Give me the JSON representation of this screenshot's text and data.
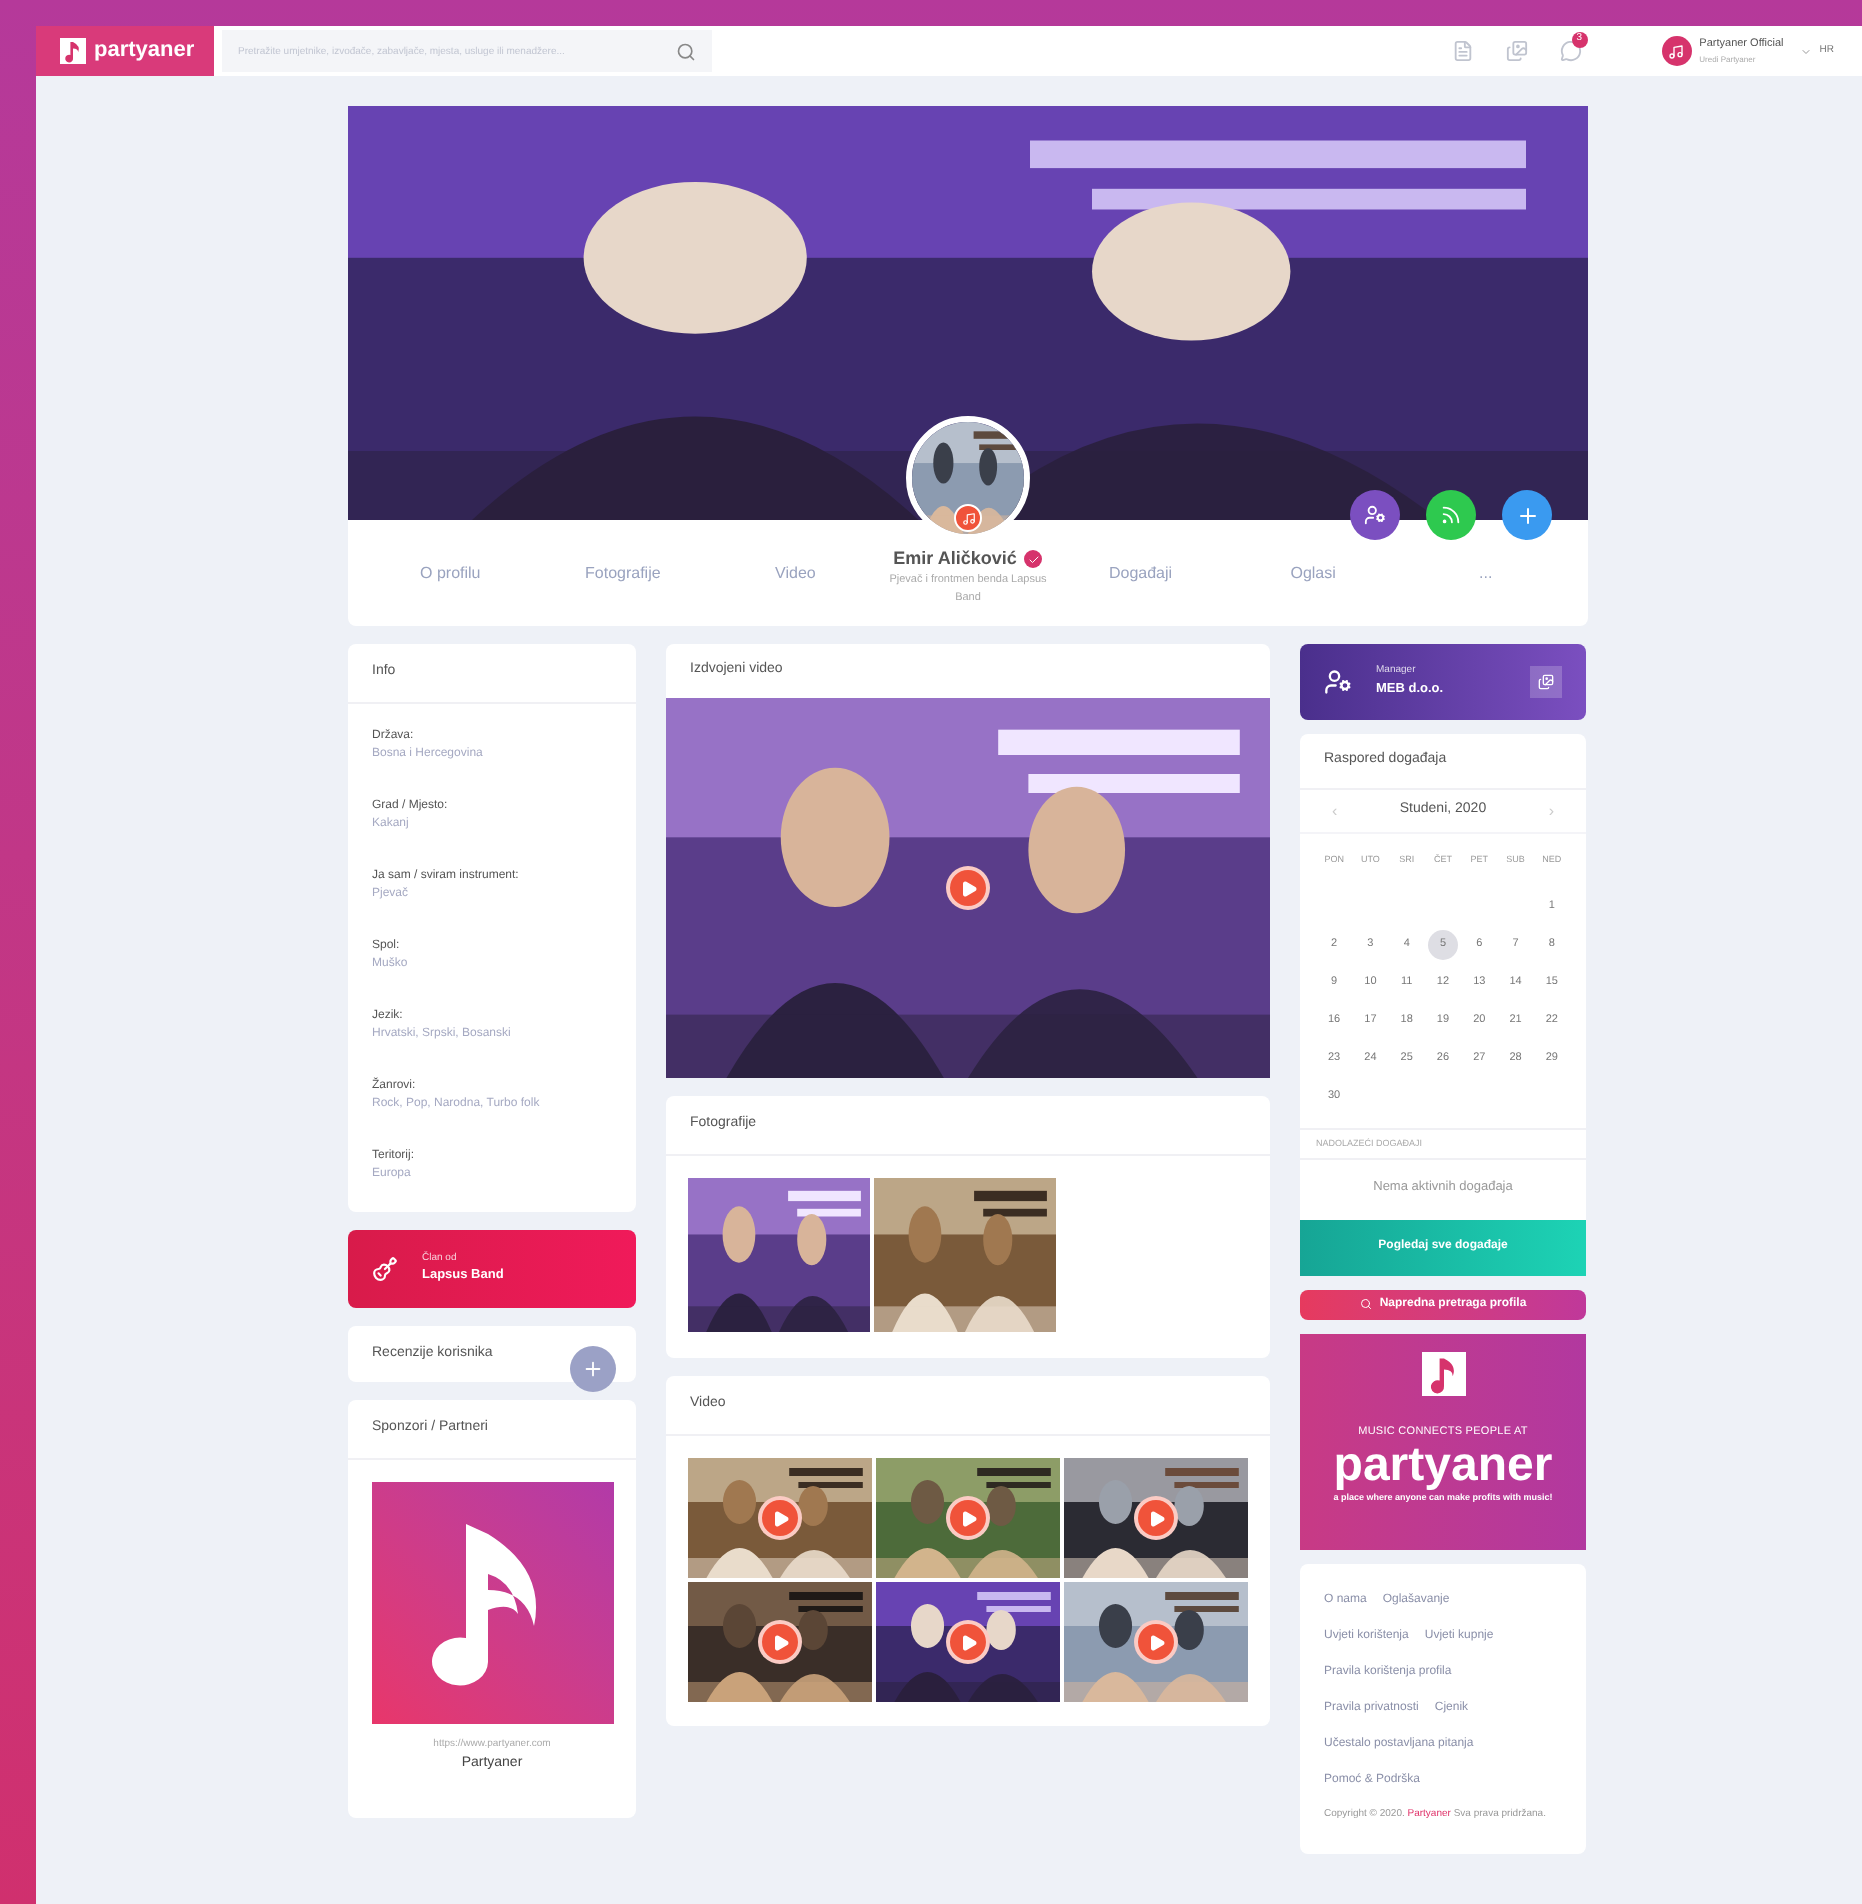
{
  "topbar": {
    "logo": "partyaner",
    "search": {
      "placeholder": "Pretražite umjetnike, izvođače, zabavljače, mjesta, usluge ili menadžere..."
    },
    "notification_count": "3",
    "user": {
      "name": "Partyaner Official",
      "subtitle": "Uredi Partyaner"
    },
    "language": "HR"
  },
  "profile": {
    "name": "Emir Aličković",
    "verified": true,
    "role": "Pjevač i frontmen benda Lapsus Band",
    "tabs_left": [
      "O profilu",
      "Fotografije",
      "Video"
    ],
    "tabs_right": [
      "Događaji",
      "Oglasi",
      "..."
    ]
  },
  "info": {
    "title": "Info",
    "fields": [
      {
        "label": "Država:",
        "value": "Bosna i Hercegovina"
      },
      {
        "label": "Grad / Mjesto:",
        "value": "Kakanj"
      },
      {
        "label": "Ja sam / sviram instrument:",
        "value": "Pjevač"
      },
      {
        "label": "Spol:",
        "value": "Muško"
      },
      {
        "label": "Jezik:",
        "value": "Hrvatski, Srpski, Bosanski"
      },
      {
        "label": "Žanrovi:",
        "value": "Rock, Pop, Narodna, Turbo folk"
      },
      {
        "label": "Teritorij:",
        "value": "Europa"
      }
    ]
  },
  "member_of": {
    "label": "Član od",
    "band": "Lapsus Band"
  },
  "reviews": {
    "title": "Recenzije korisnika"
  },
  "sponsors": {
    "title": "Sponzori / Partneri",
    "url": "https://www.partyaner.com",
    "name": "Partyaner"
  },
  "featured_video": {
    "title": "Izdvojeni video"
  },
  "photos": {
    "title": "Fotografije"
  },
  "videos": {
    "title": "Video"
  },
  "manager": {
    "label": "Manager",
    "name": "MEB d.o.o."
  },
  "calendar": {
    "title": "Raspored događaja",
    "month": "Studeni, 2020",
    "prev": "‹",
    "next": "›",
    "weekdays": [
      "PON",
      "UTO",
      "SRI",
      "ČET",
      "PET",
      "SUB",
      "NED"
    ],
    "days": [
      {
        "n": "1",
        "selected": false
      },
      {
        "n": "2",
        "selected": false
      },
      {
        "n": "3",
        "selected": false
      },
      {
        "n": "4",
        "selected": false
      },
      {
        "n": "5",
        "selected": true
      },
      {
        "n": "6",
        "selected": false
      },
      {
        "n": "7",
        "selected": false
      },
      {
        "n": "8",
        "selected": false
      },
      {
        "n": "9",
        "selected": false
      },
      {
        "n": "10",
        "selected": false
      },
      {
        "n": "11",
        "selected": false
      },
      {
        "n": "12",
        "selected": false
      },
      {
        "n": "13",
        "selected": false
      },
      {
        "n": "14",
        "selected": false
      },
      {
        "n": "15",
        "selected": false
      },
      {
        "n": "16",
        "selected": false
      },
      {
        "n": "17",
        "selected": false
      },
      {
        "n": "18",
        "selected": false
      },
      {
        "n": "19",
        "selected": false
      },
      {
        "n": "20",
        "selected": false
      },
      {
        "n": "21",
        "selected": false
      },
      {
        "n": "22",
        "selected": false
      },
      {
        "n": "23",
        "selected": false
      },
      {
        "n": "24",
        "selected": false
      },
      {
        "n": "25",
        "selected": false
      },
      {
        "n": "26",
        "selected": false
      },
      {
        "n": "27",
        "selected": false
      },
      {
        "n": "28",
        "selected": false
      },
      {
        "n": "29",
        "selected": false
      },
      {
        "n": "30",
        "selected": false
      }
    ],
    "upcoming_label": "NADOLAZEĆI DOGAĐAJI",
    "empty": "Nema aktivnih događaja",
    "button": "Pogledaj sve događaje"
  },
  "advanced_search": "Napredna pretraga profila",
  "banner": {
    "line1": "MUSIC CONNECTS PEOPLE AT",
    "brand": "partyaner",
    "line2": "a place where anyone can make profits with music!"
  },
  "footer": {
    "link_rows": [
      [
        "O nama",
        "Oglašavanje"
      ],
      [
        "Uvjeti korištenja",
        "Uvjeti kupnje"
      ],
      [
        "Pravila korištenja profila"
      ],
      [
        "Pravila privatnosti",
        "Cjenik"
      ],
      [
        "Učestalo postavljana pitanja"
      ],
      [
        "Pomoć & Podrška"
      ]
    ],
    "copyright_prefix": "Copyright © 2020.",
    "copyright_link": "Partyaner",
    "copyright_suffix": "Sva prava pridržana."
  }
}
